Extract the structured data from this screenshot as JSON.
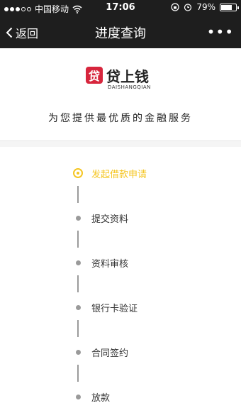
{
  "status_bar": {
    "carrier": "中国移动",
    "time": "17:06",
    "battery": "79%",
    "battery_level": 0.79
  },
  "nav": {
    "back_label": "返回",
    "title": "进度查询",
    "more_label": "•••"
  },
  "brand": {
    "logo_char": "贷",
    "name": "贷上钱",
    "pinyin": "DAISHANGQIAN",
    "slogan": "为您提供最优质的金融服务",
    "accent_color": "#d7263d"
  },
  "steps": [
    {
      "label": "发起借款申请",
      "active": true
    },
    {
      "label": "提交资料",
      "active": false
    },
    {
      "label": "资料审核",
      "active": false
    },
    {
      "label": "银行卡验证",
      "active": false
    },
    {
      "label": "合同签约",
      "active": false
    },
    {
      "label": "放款",
      "active": false
    }
  ],
  "colors": {
    "active": "#f5c623",
    "inactive": "#9a9a9a",
    "bar": "#1e1e1e"
  }
}
